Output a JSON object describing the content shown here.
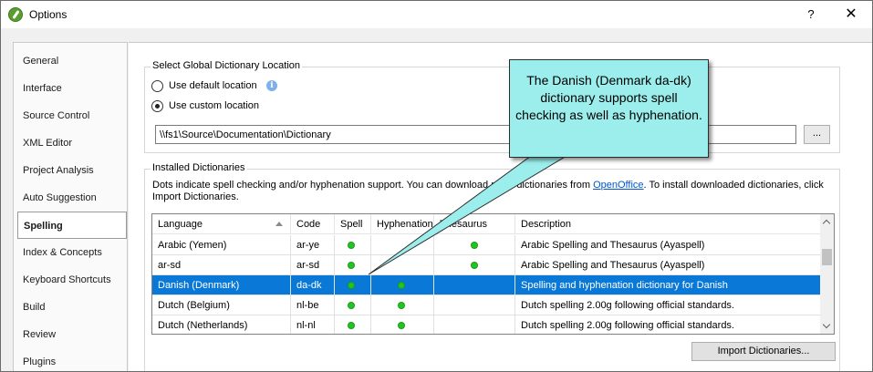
{
  "window": {
    "title": "Options",
    "help_label": "?",
    "close_label": "✕"
  },
  "sidebar": {
    "items": [
      {
        "label": "General"
      },
      {
        "label": "Interface"
      },
      {
        "label": "Source Control"
      },
      {
        "label": "XML Editor"
      },
      {
        "label": "Project Analysis"
      },
      {
        "label": "Auto Suggestion"
      },
      {
        "label": "Spelling",
        "active": true
      },
      {
        "label": "Index & Concepts"
      },
      {
        "label": "Keyboard Shortcuts"
      },
      {
        "label": "Build"
      },
      {
        "label": "Review"
      },
      {
        "label": "Plugins"
      }
    ]
  },
  "global_location": {
    "title": "Select Global Dictionary Location",
    "default_label": "Use default location",
    "custom_label": "Use custom location",
    "selected": "custom",
    "path_value": "\\\\fs1\\Source\\Documentation\\Dictionary",
    "browse_label": "..."
  },
  "installed": {
    "title": "Installed Dictionaries",
    "description_prefix": "Dots indicate spell checking and/or hyphenation support. You can download more dictionaries from ",
    "link_text": "OpenOffice",
    "description_suffix": ". To install downloaded dictionaries, click Import Dictionaries.",
    "columns": [
      "Language",
      "Code",
      "Spell",
      "Hyphenation",
      "Thesaurus",
      "Description"
    ],
    "rows": [
      {
        "language": "Arabic (Yemen)",
        "code": "ar-ye",
        "spell": true,
        "hyphen": false,
        "thesaurus": true,
        "description": "Arabic Spelling and Thesaurus (Ayaspell)"
      },
      {
        "language": "ar-sd",
        "code": "ar-sd",
        "spell": true,
        "hyphen": false,
        "thesaurus": true,
        "description": "Arabic Spelling and Thesaurus (Ayaspell)"
      },
      {
        "language": "Danish (Denmark)",
        "code": "da-dk",
        "spell": true,
        "hyphen": true,
        "thesaurus": false,
        "description": "Spelling and hyphenation dictionary for Danish",
        "selected": true
      },
      {
        "language": "Dutch (Belgium)",
        "code": "nl-be",
        "spell": true,
        "hyphen": true,
        "thesaurus": false,
        "description": "Dutch spelling 2.00g following official standards."
      },
      {
        "language": "Dutch (Netherlands)",
        "code": "nl-nl",
        "spell": true,
        "hyphen": true,
        "thesaurus": false,
        "description": "Dutch spelling 2.00g following official standards."
      }
    ],
    "import_label": "Import Dictionaries..."
  },
  "callout": {
    "text": "The Danish (Denmark da-dk) dictionary supports spell checking as well as hyphenation.",
    "fill": "#9ceeed"
  },
  "colors": {
    "selection": "#0a78d7",
    "dot": "#22c422",
    "link": "#0055cc"
  }
}
